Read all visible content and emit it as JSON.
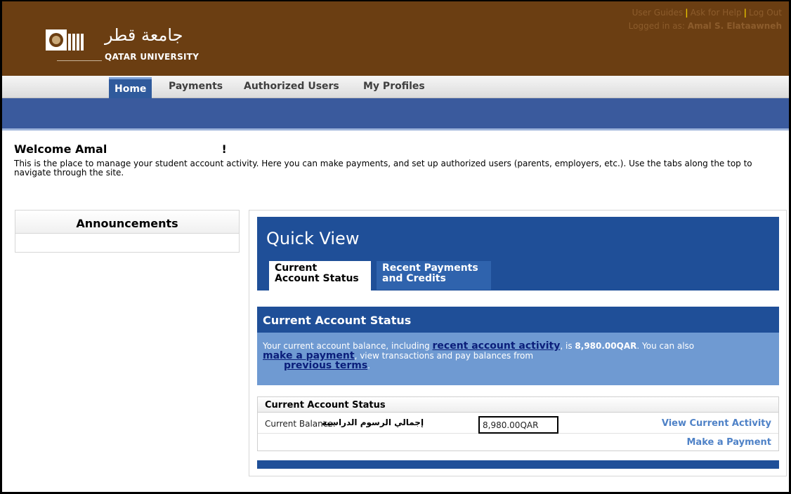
{
  "header": {
    "logo_arabic": "جامعة قطر",
    "logo_english": "QATAR UNIVERSITY",
    "links": [
      "User Guides",
      "Ask for Help",
      "Log Out"
    ],
    "logged_in_label": "Logged in as:",
    "logged_in_user": "Amal S. Elataawneh"
  },
  "nav": {
    "tabs": [
      {
        "label": "Home",
        "active": true
      },
      {
        "label": "Payments",
        "active": false
      },
      {
        "label": "Authorized Users",
        "active": false
      },
      {
        "label": "My Profiles",
        "active": false
      }
    ]
  },
  "welcome": {
    "greeting": "Welcome Amal",
    "exclaim": "!",
    "intro": "This is the place to manage your student account activity. Here you can make payments, and set up authorized users (parents, employers, etc.). Use the tabs along the top to navigate through the site."
  },
  "announcements": {
    "title": "Announcements"
  },
  "quick_view": {
    "title": "Quick View",
    "tabs": [
      "Current Account Status",
      "Recent Payments and Credits"
    ],
    "tab_active_line1": "Current",
    "tab_active_line2": "Account Status",
    "tab_inactive_line1": "Recent Payments",
    "tab_inactive_line2": "and Credits"
  },
  "account_status": {
    "heading": "Current Account Status",
    "text_1": "Your current account balance, including ",
    "link_recent": "recent account activity",
    "text_2": ", is ",
    "balance_bold": "8,980.00QAR",
    "text_3": ". You can also",
    "link_payment": "make a payment",
    "text_4": ", view transactions and pay balances from",
    "link_previous": "previous terms",
    "text_5": "."
  },
  "status_table": {
    "heading": "Current Account Status",
    "balance_label": "Current Balance:",
    "balance_arabic": "إجمالي الرسوم الدراسية",
    "balance_value": "8,980.00QAR",
    "view_activity_link": "View Current Activity",
    "make_payment_link": "Make a Payment"
  },
  "colors": {
    "header_brown": "#6b3e12",
    "nav_blue": "#3a5a9d",
    "panel_blue": "#1f4f98",
    "info_blue": "#6f9ad2",
    "link_blue": "#4f82c7"
  }
}
